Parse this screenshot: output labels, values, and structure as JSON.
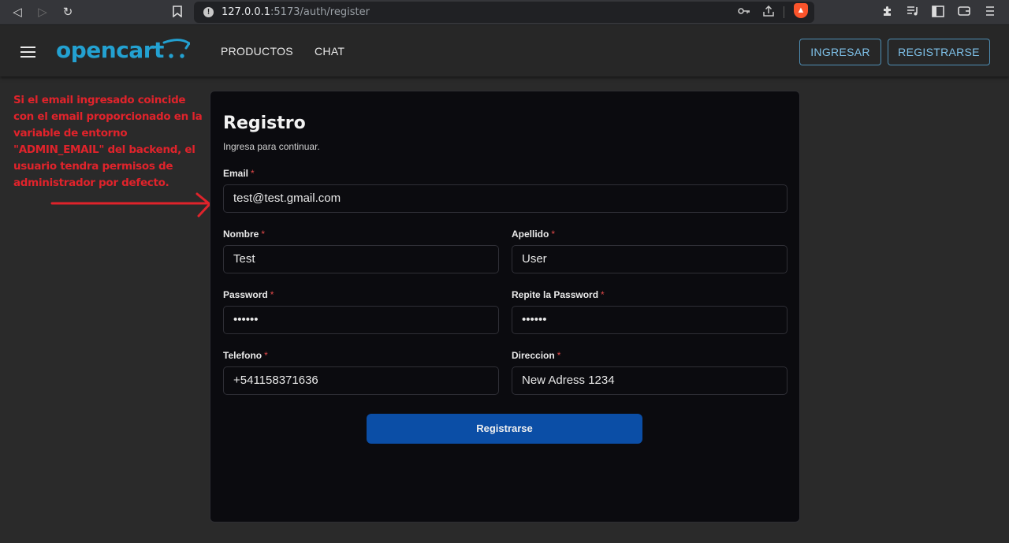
{
  "browser": {
    "url_host": "127.0.0.1",
    "url_rest": ":5173/auth/register"
  },
  "header": {
    "logo": "opencart",
    "nav": [
      "PRODUCTOS",
      "CHAT"
    ],
    "login_label": "INGRESAR",
    "register_label": "REGISTRARSE"
  },
  "annotation": {
    "text": "Si el email ingresado coincide con el email proporcionado en la variable de entorno \"ADMIN_EMAIL\" del backend, el usuario tendra permisos de administrador por defecto.",
    "color": "#e0232b"
  },
  "form": {
    "title": "Registro",
    "subtitle": "Ingresa para continuar.",
    "required_mark": "*",
    "fields": {
      "email": {
        "label": "Email",
        "value": "test@test.gmail.com"
      },
      "nombre": {
        "label": "Nombre",
        "value": "Test"
      },
      "apellido": {
        "label": "Apellido",
        "value": "User"
      },
      "password": {
        "label": "Password",
        "value": "••••••"
      },
      "repite_password": {
        "label": "Repite la Password",
        "value": "••••••"
      },
      "telefono": {
        "label": "Telefono",
        "value": "+541158371636"
      },
      "direccion": {
        "label": "Direccion",
        "value": "New Adress 1234"
      }
    },
    "submit_label": "Registrarse"
  },
  "colors": {
    "accent": "#23a1d1",
    "submit": "#0b4ea6",
    "required": "#e04848"
  }
}
